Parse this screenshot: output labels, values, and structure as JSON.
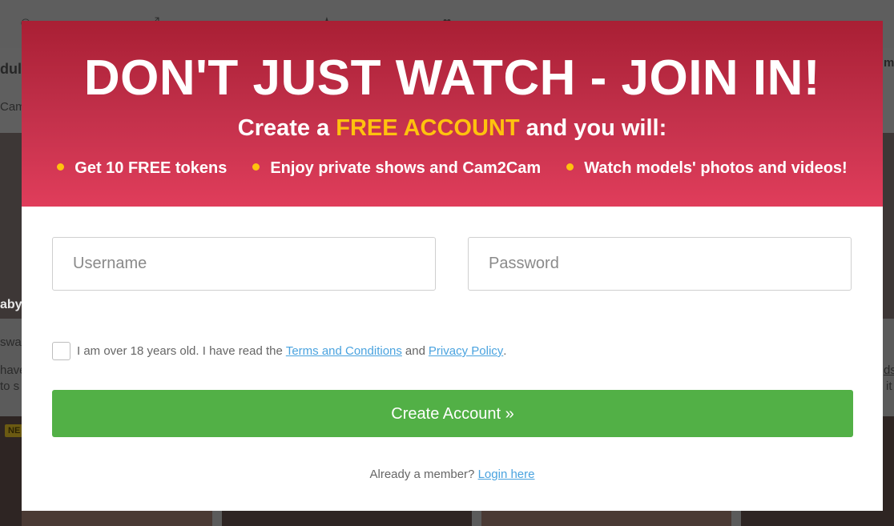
{
  "background": {
    "cut_text_1": "dul",
    "cut_text_2": "Cam",
    "cut_text_3": "aby",
    "cut_text_4": "swap",
    "cut_text_5": "have",
    "cut_text_6": "to s",
    "cut_text_7": "ma",
    "cut_text_8": "ds",
    "cut_text_9": "it",
    "new_badge": "NE"
  },
  "modal": {
    "headline": "DON'T JUST WATCH - JOIN IN!",
    "subline_before": "Create a ",
    "subline_highlight": "FREE ACCOUNT",
    "subline_after": " and you will:",
    "perks": [
      "Get 10 FREE tokens",
      "Enjoy private shows and Cam2Cam",
      "Watch models' photos and videos!"
    ],
    "username_placeholder": "Username",
    "password_placeholder": "Password",
    "agree_text": "I am over 18 years old. I have read the",
    "terms_link": "Terms and Conditions",
    "and_text": "and",
    "privacy_link": "Privacy Policy",
    "period": ".",
    "create_button": "Create Account »",
    "member_text": "Already a member?",
    "login_link": "Login here"
  },
  "colors": {
    "header_top": "#a91f34",
    "header_bottom": "#e03d5b",
    "highlight": "#ffc20e",
    "button_green": "#52b046",
    "link_blue": "#4aa3df"
  }
}
